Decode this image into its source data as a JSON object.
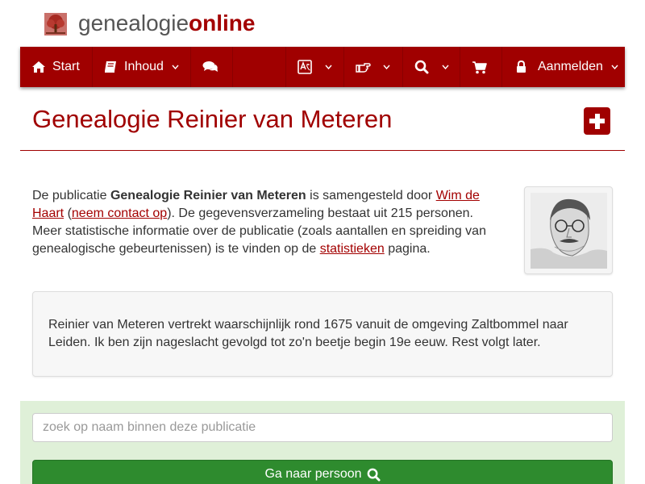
{
  "logo": {
    "text_plain": "genealogie",
    "text_bold": "online"
  },
  "nav": {
    "start_label": "Start",
    "content_label": "Inhoud",
    "login_label": "Aanmelden"
  },
  "icons": {
    "logo": "tree-icon",
    "home": "home-icon",
    "book": "book-icon",
    "comments": "comments-icon",
    "language": "language-icon",
    "hand": "hand-pointer-icon",
    "search": "search-icon",
    "cart": "cart-icon",
    "lock": "lock-icon",
    "caret": "chevron-down-icon",
    "plus": "plus-square-icon"
  },
  "page": {
    "title": "Genealogie Reinier van Meteren"
  },
  "intro": {
    "t1": "De publicatie ",
    "pub_name": "Genealogie Reinier van Meteren",
    "t2": " is samengesteld door ",
    "author_link": "Wim de Haart",
    "t3": " (",
    "contact_link": "neem contact op",
    "t4": "). De gegevensverzameling bestaat uit 215 personen. Meer statistische informatie over de publicatie (zoals aantallen en spreiding van genealogische gebeurtenissen) is te vinden op de ",
    "stats_link": "statistieken",
    "t5": " pagina."
  },
  "description": "Reinier van Meteren vertrekt waarschijnlijk rond 1675 vanuit de omgeving Zaltbommel naar Leiden. Ik ben zijn nageslacht gevolgd tot zo'n beetje begin 19e eeuw. Rest volgt later.",
  "search": {
    "placeholder": "zoek op naam binnen deze publicatie",
    "button_label": "Ga naar persoon"
  },
  "colors": {
    "brand_red": "#a00000",
    "search_panel": "#dff0d8",
    "button_green": "#2e8b2e"
  }
}
